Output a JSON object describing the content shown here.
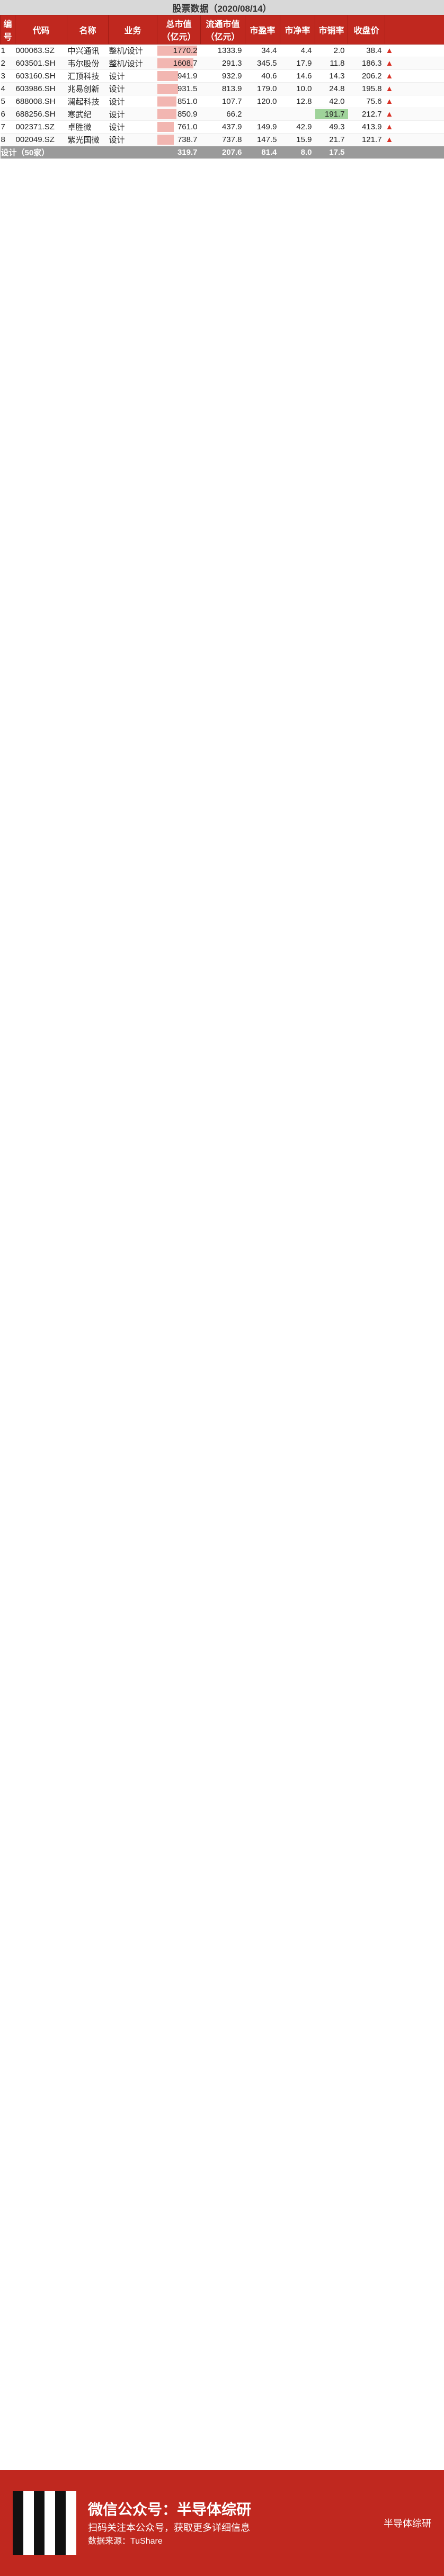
{
  "header": {
    "title": "股票数据（2020/08/14）",
    "columns": [
      "编号",
      "代码",
      "名称",
      "业务",
      "总市值（亿元）",
      "流通市值（亿元）",
      "市盈率",
      "市净率",
      "市销率",
      "收盘价"
    ]
  },
  "rows": [
    {
      "no": "1",
      "code": "000063.SZ",
      "name": "中兴通讯",
      "biz": "整机/设计",
      "cap": "1770.2",
      "float": "1333.9",
      "pe": "34.4",
      "pb": "4.4",
      "ps": "2.0",
      "close": "38.4"
    },
    {
      "no": "2",
      "code": "603501.SH",
      "name": "韦尔股份",
      "biz": "整机/设计",
      "cap": "1608.7",
      "float": "291.3",
      "pe": "345.5",
      "pb": "17.9",
      "ps": "11.8",
      "close": "186.3"
    },
    {
      "no": "3",
      "code": "603160.SH",
      "name": "汇顶科技",
      "biz": "设计",
      "cap": "941.9",
      "float": "932.9",
      "pe": "40.6",
      "pb": "14.6",
      "ps": "14.3",
      "close": "206.2"
    },
    {
      "no": "4",
      "code": "603986.SH",
      "name": "兆易创新",
      "biz": "设计",
      "cap": "931.5",
      "float": "813.9",
      "pe": "179.0",
      "pb": "10.0",
      "ps": "24.8",
      "close": "195.8"
    },
    {
      "no": "5",
      "code": "688008.SH",
      "name": "澜起科技",
      "biz": "设计",
      "cap": "851.0",
      "float": "107.7",
      "pe": "120.0",
      "pb": "12.8",
      "ps": "42.0",
      "close": "75.6"
    },
    {
      "no": "6",
      "code": "688256.SH",
      "name": "寒武纪",
      "biz": "设计",
      "cap": "850.9",
      "float": "66.2",
      "pe": "",
      "pb": "",
      "ps": "191.7",
      "close": "212.7"
    },
    {
      "no": "7",
      "code": "002371.SZ",
      "name": "卓胜微",
      "biz": "设计",
      "cap": "761.0",
      "float": "437.9",
      "pe": "149.9",
      "pb": "42.9",
      "ps": "49.3",
      "close": "413.9"
    },
    {
      "no": "8",
      "code": "002049.SZ",
      "name": "紫光国微",
      "biz": "设计",
      "cap": "738.7",
      "float": "737.8",
      "pe": "147.5",
      "pb": "15.9",
      "ps": "21.7",
      "close": "121.7"
    }
  ],
  "summary": {
    "label": "设计（50家）",
    "cap": "319.7",
    "float": "207.6",
    "pe": "81.4",
    "pb": "8.0",
    "ps": "17.5"
  },
  "footer": {
    "title": "微信公众号：半导体综研",
    "subtitle": "扫码关注本公众号，获取更多详细信息",
    "source": "数据来源：TuShare",
    "brand": "半导体综研"
  },
  "colors": {
    "header_red": "#c0281f",
    "bar_red": "#f2b6b1",
    "bar_green": "#9fd39a",
    "summary_gray": "#9a9a9a"
  }
}
